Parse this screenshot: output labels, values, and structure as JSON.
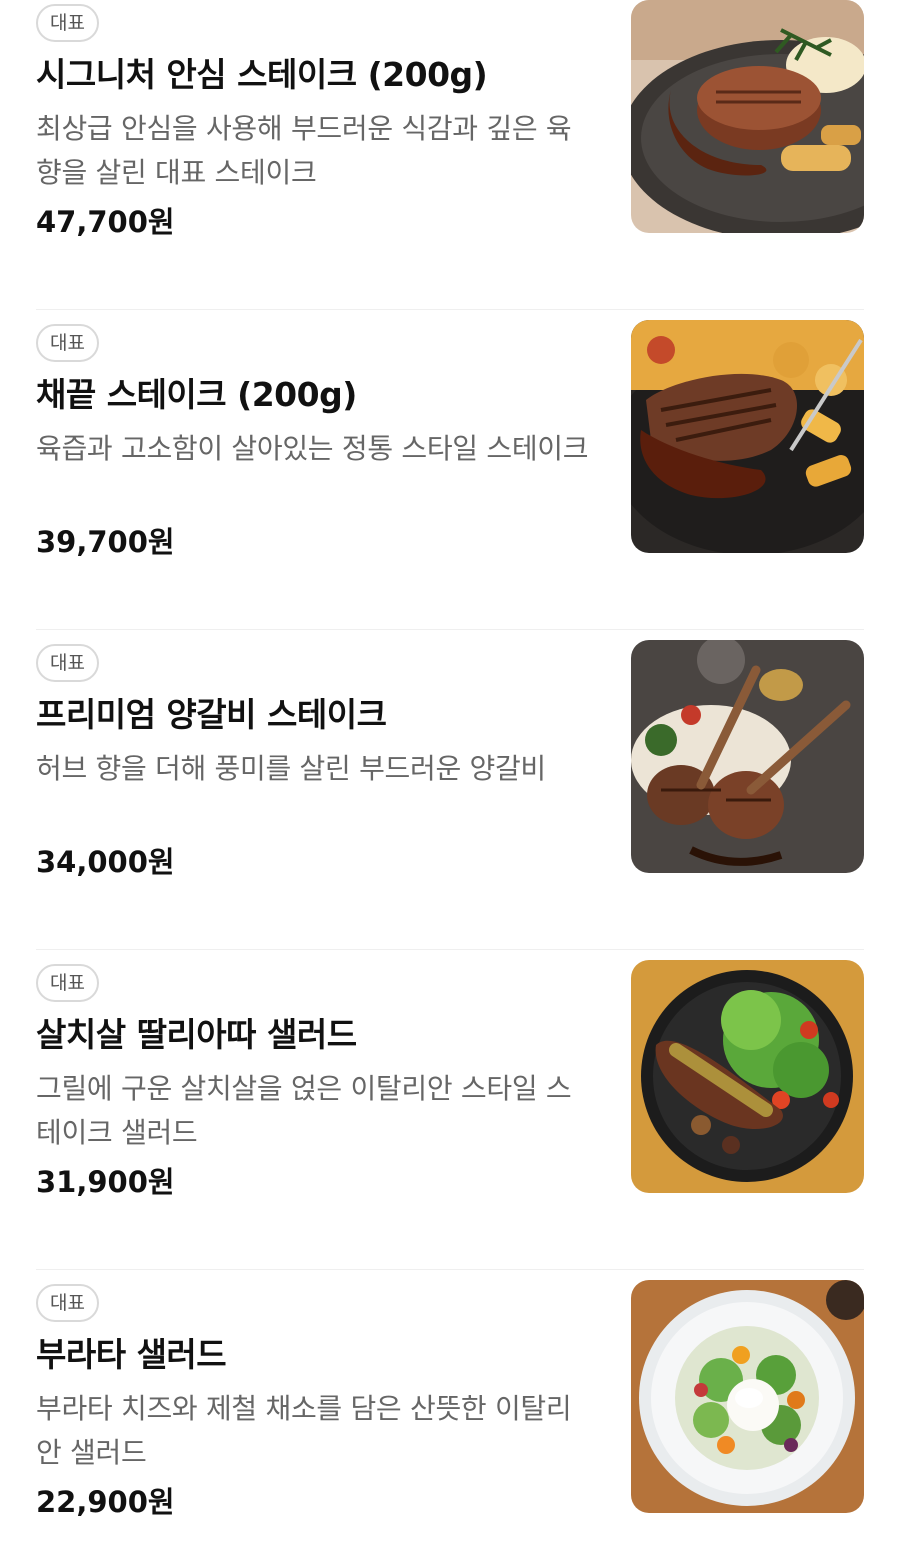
{
  "menu": {
    "items": [
      {
        "badge": "대표",
        "name": "시그니처 안심 스테이크 (200g)",
        "description": "최상급 안심을 사용해 부드러운 식감과 깊은 육향을 살린 대표 스테이크",
        "price": "47,700원",
        "image_icon": "filet-steak-photo"
      },
      {
        "badge": "대표",
        "name": "채끝 스테이크 (200g)",
        "description": "육즙과 고소함이 살아있는 정통 스타일 스테이크",
        "price": "39,700원",
        "image_icon": "sirloin-steak-photo"
      },
      {
        "badge": "대표",
        "name": "프리미엄 양갈비 스테이크",
        "description": "허브 향을 더해 풍미를 살린 부드러운 양갈비",
        "price": "34,000원",
        "image_icon": "lamb-rack-photo"
      },
      {
        "badge": "대표",
        "name": "살치살 딸리아따 샐러드",
        "description": "그릴에 구운 살치살을 얹은 이탈리안 스타일 스테이크 샐러드",
        "price": "31,900원",
        "image_icon": "tagliata-salad-photo"
      },
      {
        "badge": "대표",
        "name": "부라타 샐러드",
        "description": "부라타 치즈와 제철 채소를 담은 산뜻한 이탈리안 샐러드",
        "price": "22,900원",
        "image_icon": "burrata-salad-photo"
      }
    ]
  }
}
